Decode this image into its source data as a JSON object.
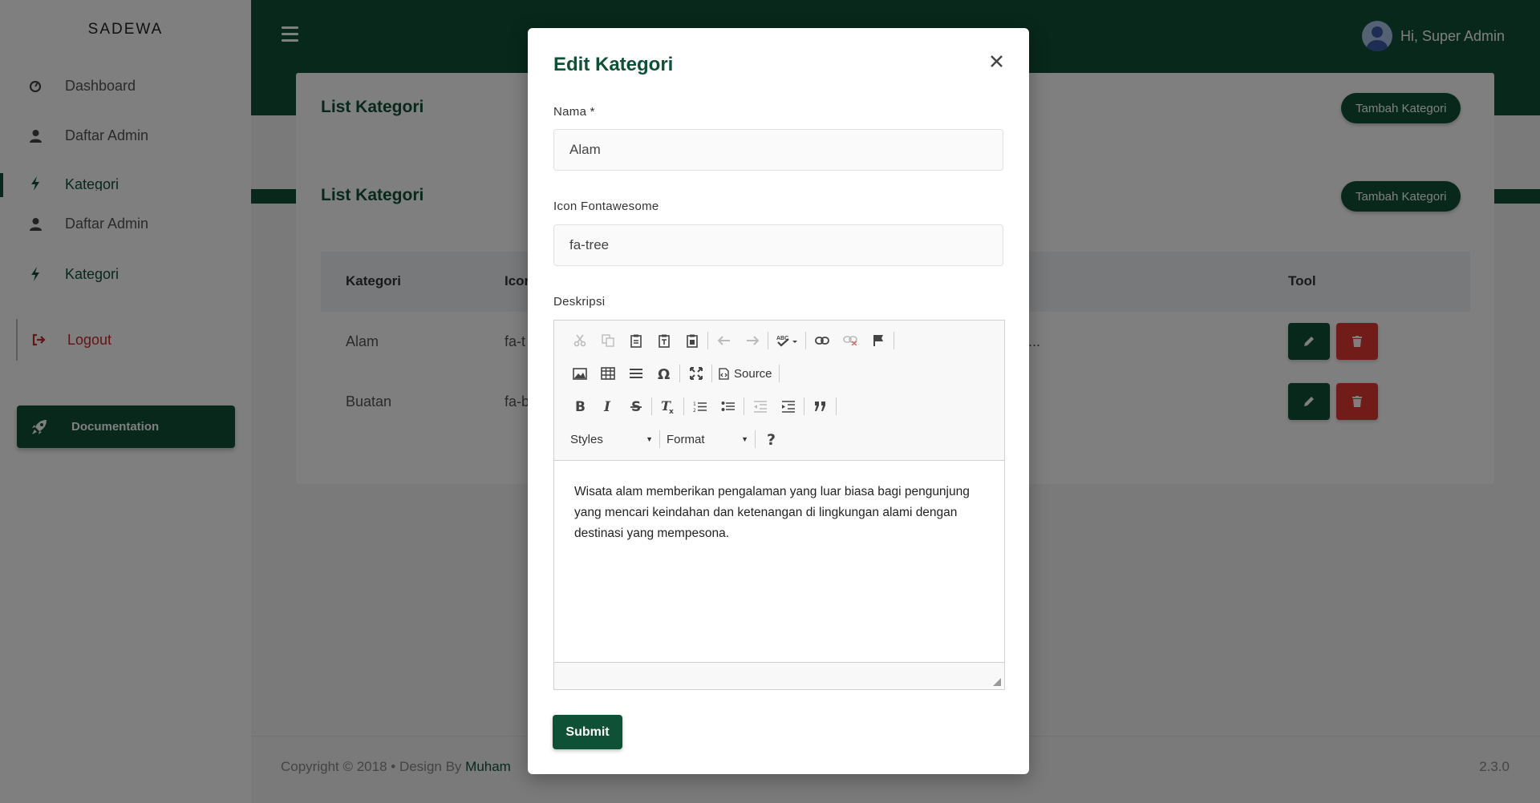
{
  "brand": "SADEWA",
  "sidebar": {
    "items": [
      {
        "label": "Dashboard",
        "icon": "gauge-icon"
      },
      {
        "label": "Daftar Admin",
        "icon": "user-icon"
      },
      {
        "label": "Kategori",
        "icon": "bolt-icon"
      },
      {
        "label": "Daftar Admin",
        "icon": "user-icon"
      },
      {
        "label": "Kategori",
        "icon": "bolt-icon"
      }
    ],
    "logout": "Logout",
    "documentation": "Documentation"
  },
  "header": {
    "greeting": "Hi, Super Admin"
  },
  "card": {
    "title": "List Kategori",
    "add_button": "Tambah Kategori",
    "columns": [
      "Kategori",
      "Icon",
      "Tool"
    ],
    "rows": [
      {
        "kategori": "Alam",
        "icon": "fa-t"
      },
      {
        "kategori": "Buatan",
        "icon": "fa-b"
      }
    ],
    "ellipsis": "..."
  },
  "footer": {
    "copyright": "Copyright © 2018  •  Design By ",
    "author": "Muham",
    "version": "2.3.0"
  },
  "modal": {
    "title": "Edit Kategori",
    "nama_label": "Nama *",
    "nama_value": "Alam",
    "icon_label": "Icon Fontawesome",
    "icon_value": "fa-tree",
    "desc_label": "Deskripsi",
    "toolbar": {
      "source": "Source",
      "styles": "Styles",
      "format": "Format"
    },
    "description": "Wisata alam memberikan pengalaman yang luar biasa bagi pengunjung yang mencari keindahan dan ketenangan di lingkungan alami dengan destinasi yang mempesona.",
    "submit": "Submit"
  },
  "colors": {
    "brand_green": "#0e5137",
    "danger": "#e53935",
    "overlay": "rgba(0,0,0,0.5)"
  }
}
